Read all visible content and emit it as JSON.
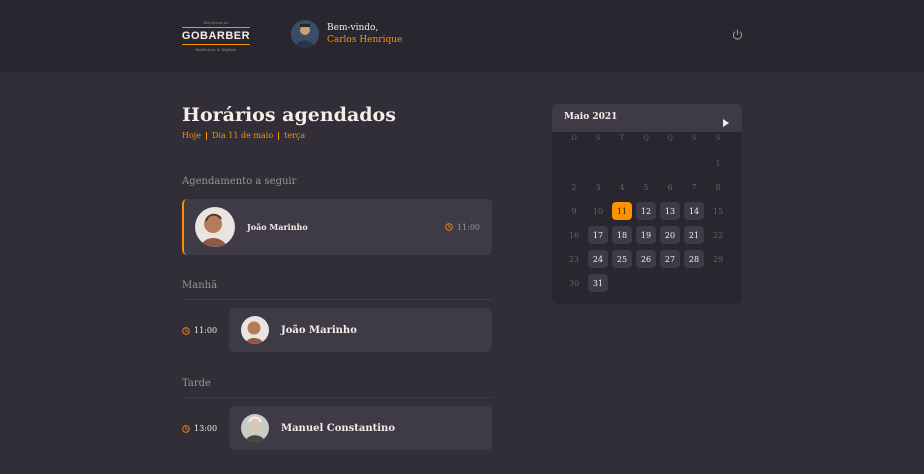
{
  "header": {
    "logo": {
      "top_text": "Barbearia",
      "brand": "GOBARBER",
      "bottom_text": "Barbeiros & Stylists"
    },
    "welcome": "Bem-vindo,",
    "user_name": "Carlos Henrique",
    "power_icon": "power-icon"
  },
  "main": {
    "title": "Horários agendados",
    "subtitle": {
      "today": "Hoje",
      "date": "Dia 11 de maio",
      "weekday": "terça"
    },
    "next_label": "Agendamento a seguir",
    "next": {
      "name": "João Marinho",
      "time": "11:00"
    },
    "morning": {
      "label": "Manhã",
      "items": [
        {
          "time": "11:00",
          "name": "João Marinho"
        }
      ]
    },
    "afternoon": {
      "label": "Tarde",
      "items": [
        {
          "time": "13:00",
          "name": "Manuel Constantino"
        }
      ]
    }
  },
  "calendar": {
    "month": "Maio 2021",
    "weekdays": [
      "D",
      "S",
      "T",
      "Q",
      "Q",
      "S",
      "S"
    ],
    "days": [
      "1",
      "2",
      "3",
      "4",
      "5",
      "6",
      "7",
      "8",
      "9",
      "10",
      "11",
      "12",
      "13",
      "14",
      "15",
      "16",
      "17",
      "18",
      "19",
      "20",
      "21",
      "22",
      "23",
      "24",
      "25",
      "26",
      "27",
      "28",
      "29",
      "30",
      "31"
    ],
    "selected_day": "11",
    "available_days": [
      "11",
      "12",
      "13",
      "14",
      "17",
      "18",
      "19",
      "20",
      "21",
      "24",
      "25",
      "26",
      "27",
      "28",
      "31"
    ]
  },
  "colors": {
    "accent": "#ff9000",
    "background": "#312e38",
    "header": "#28262e",
    "card": "#3e3b47"
  }
}
